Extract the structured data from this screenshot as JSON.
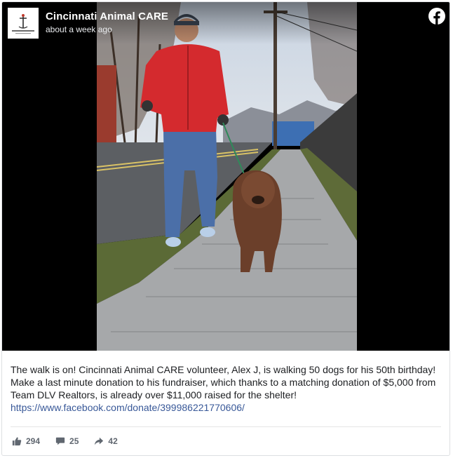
{
  "page": {
    "name": "Cincinnati Animal CARE",
    "timestamp": "about a week ago",
    "logo_text": "Cincinnati Animal CARE"
  },
  "caption": {
    "text": "The walk is on! Cincinnati Animal CARE volunteer, Alex J, is walking 50 dogs for his 50th birthday! Make a last minute donation to his fundraiser, which thanks to a matching donation of $5,000 from Team DLV Realtors, is already over $11,000 raised for the shelter!",
    "link": "https://www.facebook.com/donate/399986221770606/"
  },
  "engagement": {
    "likes": "294",
    "comments": "25",
    "shares": "42"
  },
  "colors": {
    "link": "#385898",
    "meta_text": "#606770",
    "jacket": "#d42a2e"
  },
  "icons": {
    "platform": "facebook-icon",
    "like": "thumbs-up-icon",
    "comment": "comment-icon",
    "share": "share-arrow-icon"
  }
}
